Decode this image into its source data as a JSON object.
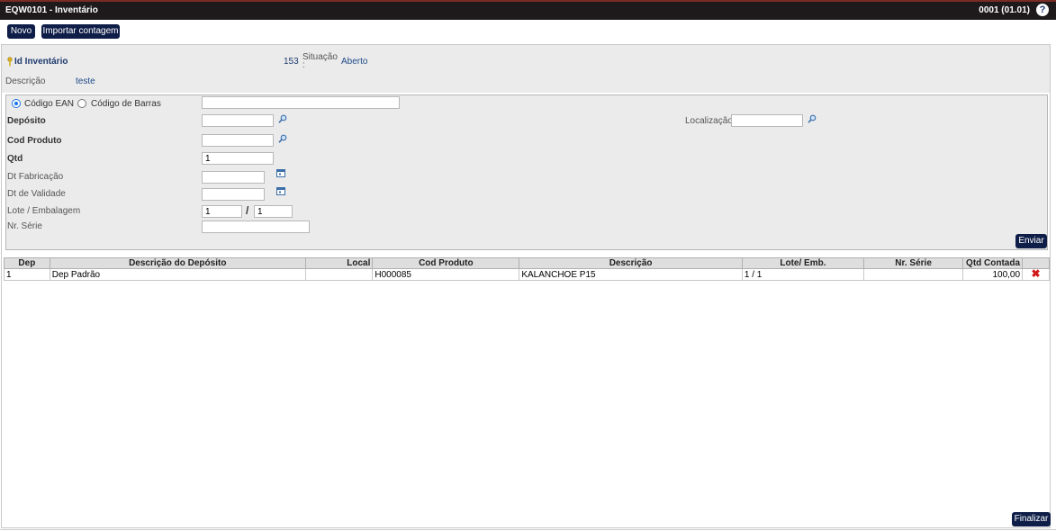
{
  "window": {
    "title": "EQW0101 - Inventário",
    "version": "0001 (01.01)",
    "help_symbol": "?"
  },
  "toolbar": {
    "novo": "Novo",
    "importar": "Importar contagem"
  },
  "header": {
    "id_label": "Id Inventário",
    "id_value": "153",
    "situacao_label": "Situação",
    "situacao_colon": ":",
    "situacao_value": "Aberto",
    "descricao_label": "Descrição",
    "descricao_value": "teste"
  },
  "form": {
    "radio_ean": "Código EAN",
    "radio_barras": "Código de Barras",
    "code_value": "",
    "deposito_label": "Depósito",
    "deposito_value": "",
    "localizacao_label": "Localização",
    "localizacao_value": "",
    "cod_produto_label": "Cod Produto",
    "cod_produto_value": "",
    "qtd_label": "Qtd",
    "qtd_value": "1",
    "dt_fabricacao_label": "Dt Fabricação",
    "dt_fabricacao_value": "",
    "dt_validade_label": "Dt de Validade",
    "dt_validade_value": "",
    "lote_label": "Lote / Embalagem",
    "lote_value": "1",
    "lote_sep": "/",
    "emb_value": "1",
    "nr_serie_label": "Nr. Série",
    "nr_serie_value": "",
    "enviar": "Enviar"
  },
  "table": {
    "columns": [
      "Dep",
      "Descrição do Depósito",
      "Local",
      "Cod Produto",
      "Descrição",
      "Lote/ Emb.",
      "Nr. Série",
      "Qtd Contada",
      ""
    ],
    "rows": [
      {
        "dep": "1",
        "desc_deposito": "Dep Padrão",
        "local": "",
        "cod_produto": "H000085",
        "descricao": "KALANCHOE P15",
        "lote_emb": "1 / 1",
        "nr_serie": "",
        "qtd": "100,00",
        "delete_symbol": "✖"
      }
    ]
  },
  "footer": {
    "finalizar": "Finalizar"
  },
  "colors": {
    "titlebar": "#1e1a1c",
    "button": "#0f1e48",
    "accent_text": "#1f4a8a",
    "delete": "#d01818"
  }
}
